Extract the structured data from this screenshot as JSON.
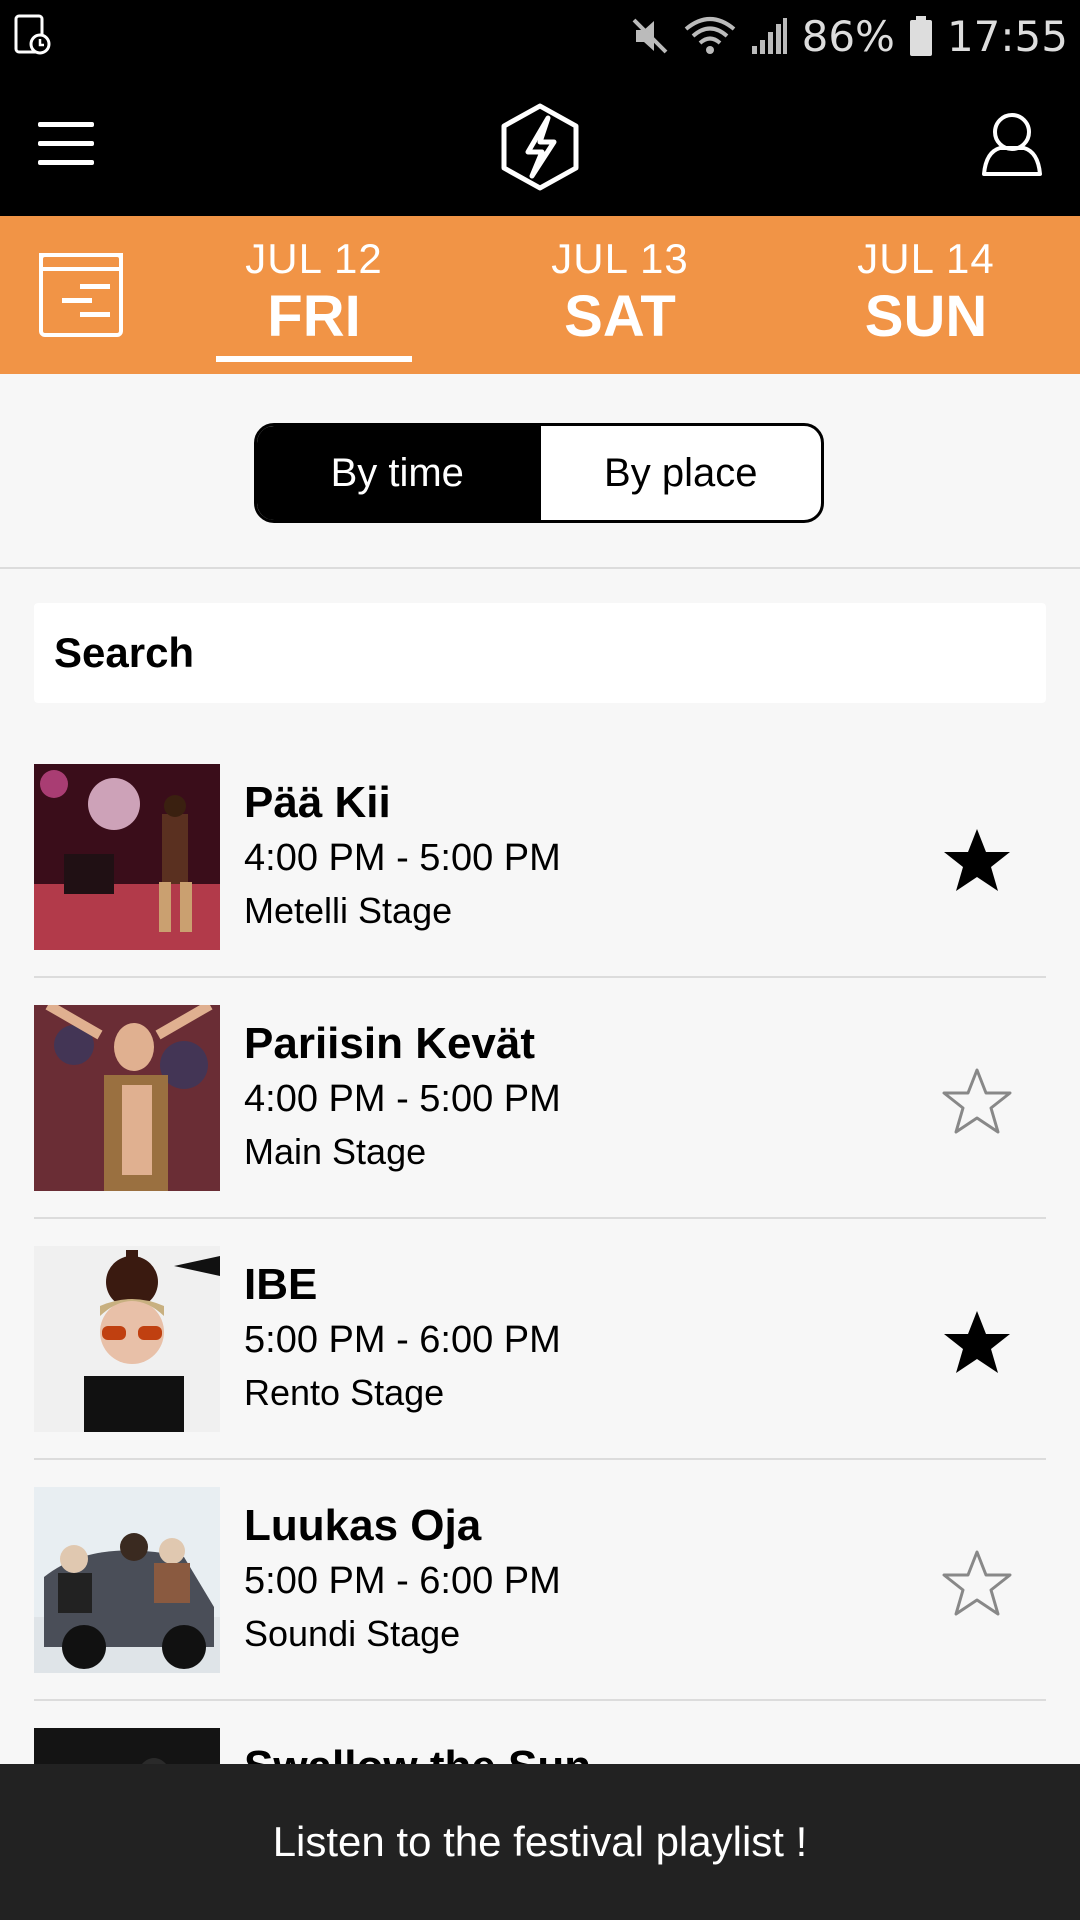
{
  "status_bar": {
    "left_icon": "screenshot-icon",
    "icons": [
      "mute-icon",
      "wifi-icon",
      "signal-icon"
    ],
    "battery": "86%",
    "time": "17:55"
  },
  "app_bar": {
    "menu_icon": "hamburger-menu-icon",
    "logo_icon": "lightning-hexagon-logo-icon",
    "profile_icon": "profile-icon"
  },
  "date_tabs": {
    "calendar_icon": "schedule-icon",
    "selected_index": 0,
    "days": [
      {
        "date": "JUL 12",
        "weekday": "FRI"
      },
      {
        "date": "JUL 13",
        "weekday": "SAT"
      },
      {
        "date": "JUL 14",
        "weekday": "SUN"
      }
    ]
  },
  "view_toggle": {
    "by_time": "By time",
    "by_place": "By place",
    "selected": "By time"
  },
  "search": {
    "placeholder": "Search"
  },
  "performances": [
    {
      "name": "Pää Kii",
      "time": "4:00 PM - 5:00 PM",
      "stage": "Metelli Stage",
      "favorite": true
    },
    {
      "name": "Pariisin Kevät",
      "time": "4:00 PM - 5:00 PM",
      "stage": "Main Stage",
      "favorite": false
    },
    {
      "name": "IBE",
      "time": "5:00 PM - 6:00 PM",
      "stage": "Rento Stage",
      "favorite": true
    },
    {
      "name": "Luukas Oja",
      "time": "5:00 PM - 6:00 PM",
      "stage": "Soundi Stage",
      "favorite": false
    },
    {
      "name": "Swallow the Sun"
    }
  ],
  "footer": {
    "playlist_label": "Listen to the festival playlist !"
  },
  "colors": {
    "accent": "#f19446",
    "bar": "#000000",
    "footer": "#222222",
    "background": "#f7f7f7"
  }
}
